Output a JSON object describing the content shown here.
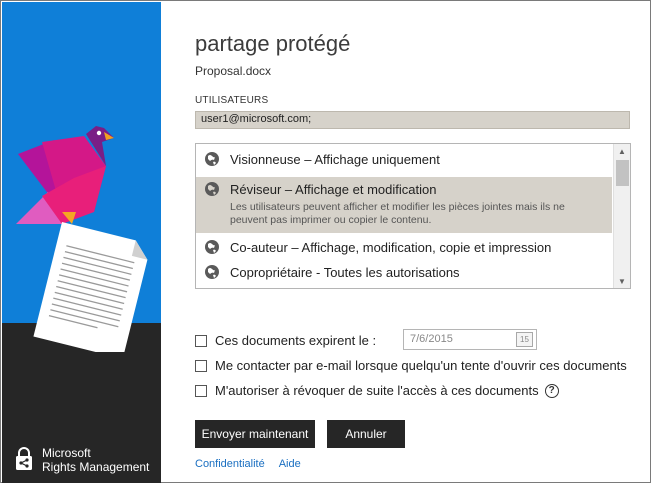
{
  "dialog": {
    "title": "partage protégé",
    "filename": "Proposal.docx"
  },
  "users": {
    "label": "UTILISATEURS",
    "value": "user1@microsoft.com;"
  },
  "permissions": [
    {
      "title": "Visionneuse – Affichage uniquement",
      "description": "",
      "selected": false,
      "icon": "globe-icon"
    },
    {
      "title": "Réviseur – Affichage et modification",
      "description": "Les utilisateurs peuvent afficher et modifier les pièces jointes mais ils ne peuvent pas imprimer ou copier le contenu.",
      "selected": true,
      "icon": "globe-icon"
    },
    {
      "title": "Co-auteur – Affichage, modification, copie et impression",
      "description": "",
      "selected": false,
      "icon": "globe-icon"
    },
    {
      "title": "Copropriétaire - Toutes les autorisations",
      "description": "",
      "selected": false,
      "icon": "globe-icon"
    }
  ],
  "options": {
    "expire_label": "Ces documents expirent le :",
    "expire_date": "7/6/2015",
    "calendar_day": "15",
    "contact_label": "Me contacter par e-mail lorsque quelqu'un tente d'ouvrir ces documents",
    "revoke_label": "M'autoriser à révoquer de suite l'accès à ces documents",
    "help_glyph": "?"
  },
  "buttons": {
    "send": "Envoyer maintenant",
    "cancel": "Annuler"
  },
  "links": {
    "privacy": "Confidentialité",
    "help": "Aide"
  },
  "brand": {
    "line1": "Microsoft",
    "line2": "Rights Management"
  },
  "colors": {
    "accent_blue": "#0f7fd8",
    "dark_panel": "#262626",
    "selected_bg": "#d6d2ca",
    "link": "#1a6fc1"
  }
}
